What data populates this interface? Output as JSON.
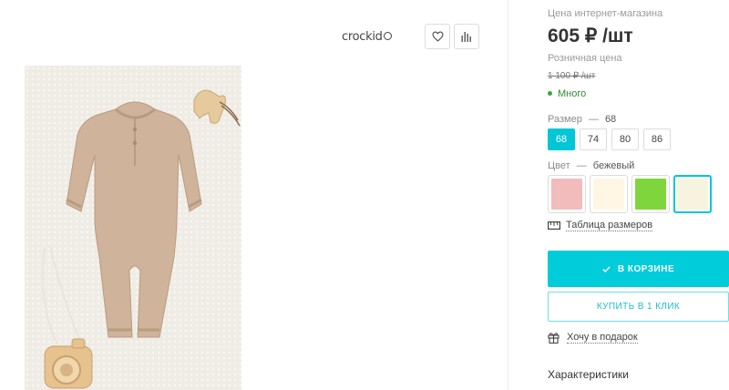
{
  "brand": {
    "name": "crockid"
  },
  "buttons": {
    "favorite_icon": "heart-icon",
    "compare_icon": "bar-chart-icon"
  },
  "pricing": {
    "online_label": "Цена интернет-магазина",
    "online_price": "605 ₽ /шт",
    "retail_label": "Розничная цена",
    "retail_price": "1 100 ₽ /шт",
    "stock": "Много",
    "stock_color": "#3aa83a"
  },
  "size": {
    "label": "Размер",
    "separator": "—",
    "selected": "68",
    "options": [
      "68",
      "74",
      "80",
      "86"
    ]
  },
  "color": {
    "label": "Цвет",
    "separator": "—",
    "selected": "бежевый",
    "swatches": [
      "#f2bcbc",
      "#fff6e4",
      "#7ed63c",
      "#f6f4de"
    ],
    "selected_index": 3
  },
  "links": {
    "size_table": "Таблица размеров",
    "gift": "Хочу в подарок"
  },
  "actions": {
    "in_cart": "В КОРЗИНЕ",
    "one_click": "КУПИТЬ В 1 КЛИК"
  },
  "sections": {
    "characteristics": "Характеристики"
  },
  "accent_color": "#00cdd9"
}
